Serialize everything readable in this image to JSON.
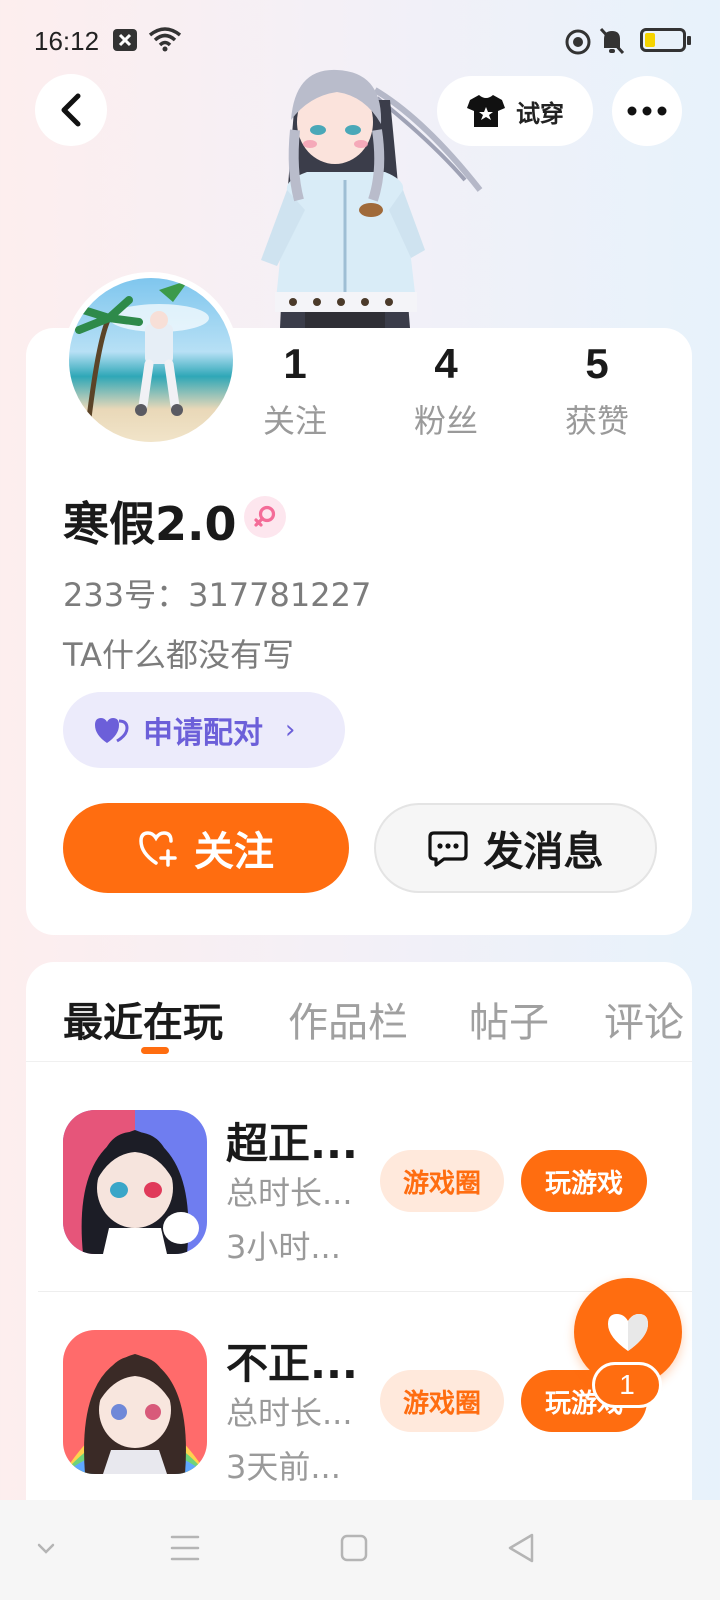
{
  "status_bar": {
    "time": "16:12"
  },
  "header": {
    "try_on_label": "试穿"
  },
  "profile": {
    "stats": [
      {
        "value": "1",
        "label": "关注"
      },
      {
        "value": "4",
        "label": "粉丝"
      },
      {
        "value": "5",
        "label": "获赞"
      }
    ],
    "username": "寒假2.0",
    "user_id": "233号：317781227",
    "bio": "TA什么都没有写",
    "match_label": "申请配对",
    "follow_label": "关注",
    "message_label": "发消息"
  },
  "tabs": [
    "最近在玩",
    "作品栏",
    "帖子",
    "评论"
  ],
  "games": [
    {
      "title": "超正...",
      "line1": "总时长...",
      "line2": "3小时...",
      "circle_label": "游戏圈",
      "play_label": "玩游戏"
    },
    {
      "title": "不正...",
      "line1": "总时长...",
      "line2": "3天前...",
      "circle_label": "游戏圈",
      "play_label": "玩游戏"
    }
  ],
  "floating_like": {
    "count": "1"
  },
  "colors": {
    "accent": "#ff6d10",
    "match": "#6c5fd9",
    "female": "#f46c98"
  }
}
